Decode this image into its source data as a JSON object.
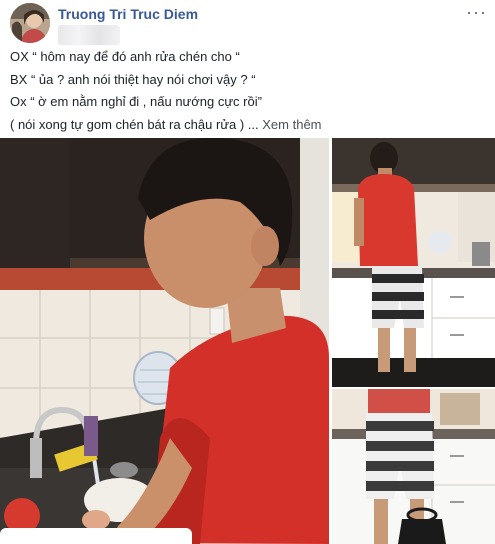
{
  "post": {
    "author_name": "Truong Tri Truc Diem",
    "more_options": "···",
    "lines": [
      "OX “ hôm nay để đó anh rửa chén cho “",
      "BX “ ủa ? anh nói thiệt hay nói chơi vậy ? “",
      "Ox “ ờ em nằm nghỉ đi , nấu nướng cực rồi”",
      "( nói xong tự gom chén bát ra chậu rửa ) ..."
    ],
    "see_more": "Xem thêm"
  },
  "icons": {
    "avatar": "profile-photo",
    "more": "more-options-icon"
  },
  "colors": {
    "author": "#385898",
    "text": "#1d2129",
    "shirt": "#d4302a"
  }
}
